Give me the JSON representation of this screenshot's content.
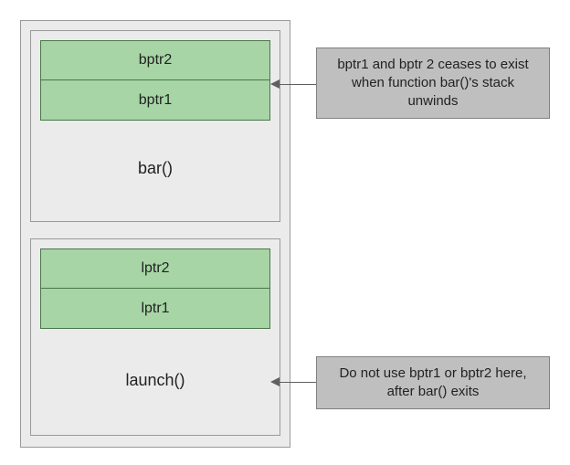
{
  "stack": {
    "frames": [
      {
        "name": "bar",
        "label": "bar()",
        "vars": [
          "bptr2",
          "bptr1"
        ]
      },
      {
        "name": "launch",
        "label": "launch()",
        "vars": [
          "lptr2",
          "lptr1"
        ]
      }
    ]
  },
  "notes": {
    "note1": "bptr1 and bptr 2 ceases to exist when function bar()'s stack unwinds",
    "note2": "Do not use bptr1 or bptr2 here, after bar() exits"
  },
  "colors": {
    "frame_bg": "#ebebeb",
    "var_bg": "#a7d5a6",
    "note_bg": "#bfbfbf"
  }
}
